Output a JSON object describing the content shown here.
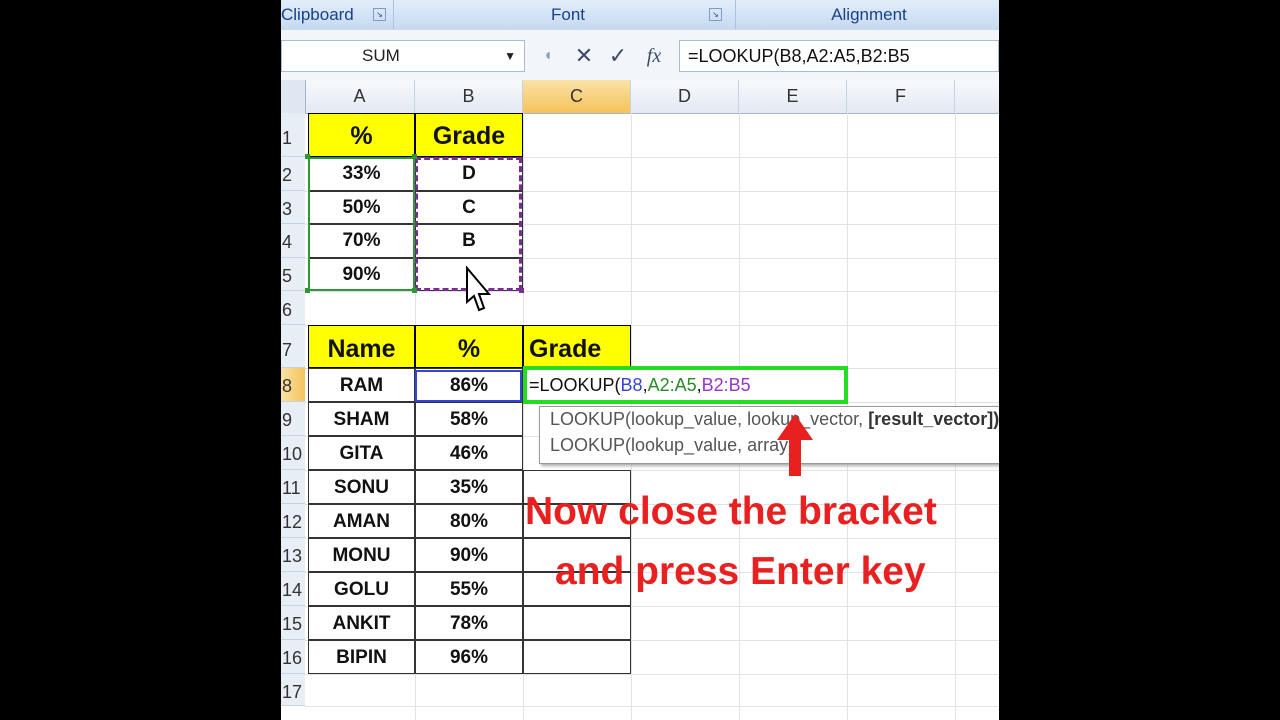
{
  "ribbon": {
    "groups": [
      {
        "label": "Clipboard"
      },
      {
        "label": "Font"
      },
      {
        "label": "Alignment"
      }
    ]
  },
  "formula_bar": {
    "name_box": "SUM",
    "cancel_icon": "✕",
    "enter_icon": "✓",
    "fx_label": "fx",
    "formula": "=LOOKUP(B8,A2:A5,B2:B5"
  },
  "columns": [
    "A",
    "B",
    "C",
    "D",
    "E",
    "F"
  ],
  "rows": [
    "1",
    "2",
    "3",
    "4",
    "5",
    "6",
    "7",
    "8",
    "9",
    "10",
    "11",
    "12",
    "13",
    "14",
    "15",
    "16",
    "17"
  ],
  "lookup_table": {
    "header_pct": "%",
    "header_grade": "Grade",
    "rows": [
      {
        "pct": "33%",
        "grade": "D"
      },
      {
        "pct": "50%",
        "grade": "C"
      },
      {
        "pct": "70%",
        "grade": "B"
      },
      {
        "pct": "90%",
        "grade": ""
      }
    ]
  },
  "students_table": {
    "header_name": "Name",
    "header_pct": "%",
    "header_grade": "Grade",
    "rows": [
      {
        "name": "RAM",
        "pct": "86%"
      },
      {
        "name": "SHAM",
        "pct": "58%"
      },
      {
        "name": "GITA",
        "pct": "46%"
      },
      {
        "name": "SONU",
        "pct": "35%"
      },
      {
        "name": "AMAN",
        "pct": "80%"
      },
      {
        "name": "MONU",
        "pct": "90%"
      },
      {
        "name": "GOLU",
        "pct": "55%"
      },
      {
        "name": "ANKIT",
        "pct": "78%"
      },
      {
        "name": "BIPIN",
        "pct": "96%"
      }
    ]
  },
  "active_cell": {
    "prefix": "=LOOKUP(",
    "ref1": "B8",
    "ref2": "A2:A5",
    "ref3": "B2:B5",
    "sep": ","
  },
  "tooltip": {
    "line1_a": "LOOKUP(lookup_value, lookup_vector, ",
    "line1_b": "[result_vector])",
    "line2": "LOOKUP(lookup_value, array)"
  },
  "annotation": {
    "line1": "Now close the bracket",
    "line2": "and press Enter key",
    "color": "#e8201f"
  },
  "colors": {
    "header_fill": "#ffff00",
    "editor_border": "#22dd22"
  }
}
